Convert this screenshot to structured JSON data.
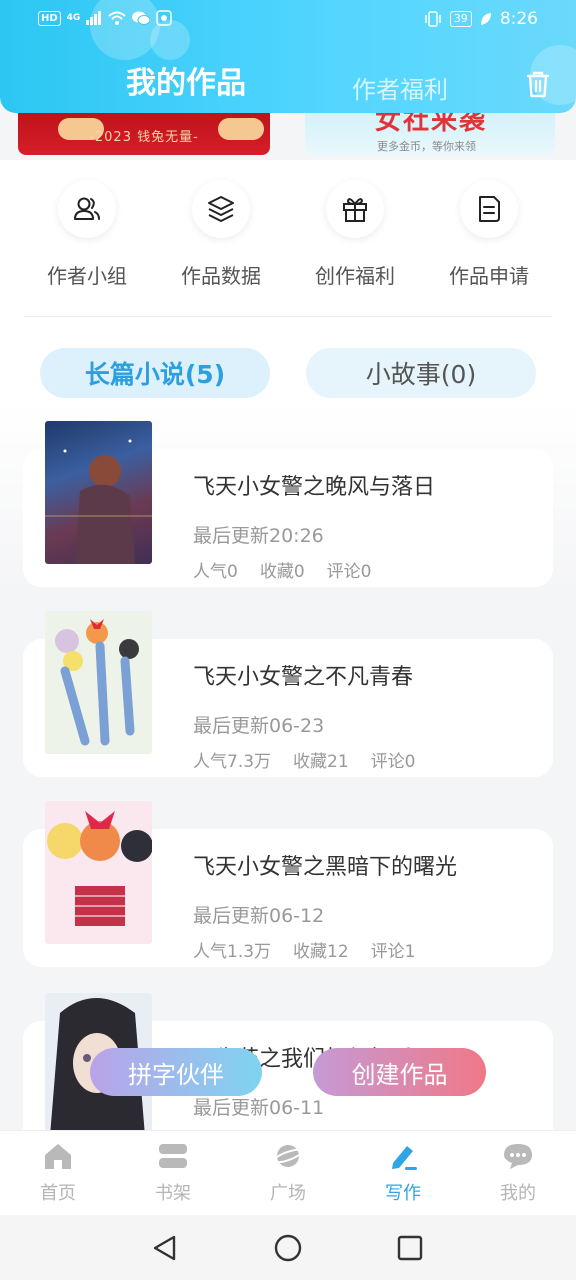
{
  "status": {
    "left_chips": [
      "HD",
      "4G"
    ],
    "time": "8:26",
    "battery": "39"
  },
  "header": {
    "tab_active": "我的作品",
    "tab_inactive": "作者福利",
    "trash_icon": "trash-icon"
  },
  "banners": {
    "left_text": "-2023 钱兔无量-",
    "right_big": "女社来袭",
    "right_small": "更多金币，等你来领"
  },
  "quick_actions": [
    {
      "label": "作者小组",
      "icon": "group-icon"
    },
    {
      "label": "作品数据",
      "icon": "layers-icon"
    },
    {
      "label": "创作福利",
      "icon": "gift-icon"
    },
    {
      "label": "作品申请",
      "icon": "document-icon"
    }
  ],
  "segments": {
    "long_novel": "长篇小说(5)",
    "short_story": "小故事(0)"
  },
  "works": [
    {
      "title": "飞天小女警之晚风与落日",
      "update": "最后更新20:26",
      "popularity": "人气0",
      "favorites": "收藏0",
      "comments": "评论0"
    },
    {
      "title": "飞天小女警之不凡青春",
      "update": "最后更新06-23",
      "popularity": "人气7.3万",
      "favorites": "收藏21",
      "comments": "评论0"
    },
    {
      "title": "飞天小女警之黑暗下的曙光",
      "update": "最后更新06-12",
      "popularity": "人气1.3万",
      "favorites": "收藏12",
      "comments": "评论1"
    },
    {
      "title": "双生花之我们如何相爱",
      "update": "最后更新06-11"
    }
  ],
  "floating": {
    "partner": "拼字伙伴",
    "create": "创建作品"
  },
  "bottom_nav": [
    {
      "label": "首页",
      "icon": "home-icon"
    },
    {
      "label": "书架",
      "icon": "bookshelf-icon"
    },
    {
      "label": "广场",
      "icon": "planet-icon"
    },
    {
      "label": "写作",
      "icon": "pen-icon"
    },
    {
      "label": "我的",
      "icon": "chat-bubble-icon"
    }
  ],
  "colors": {
    "accent": "#2fa5e6",
    "header": "#2cc6f3"
  }
}
